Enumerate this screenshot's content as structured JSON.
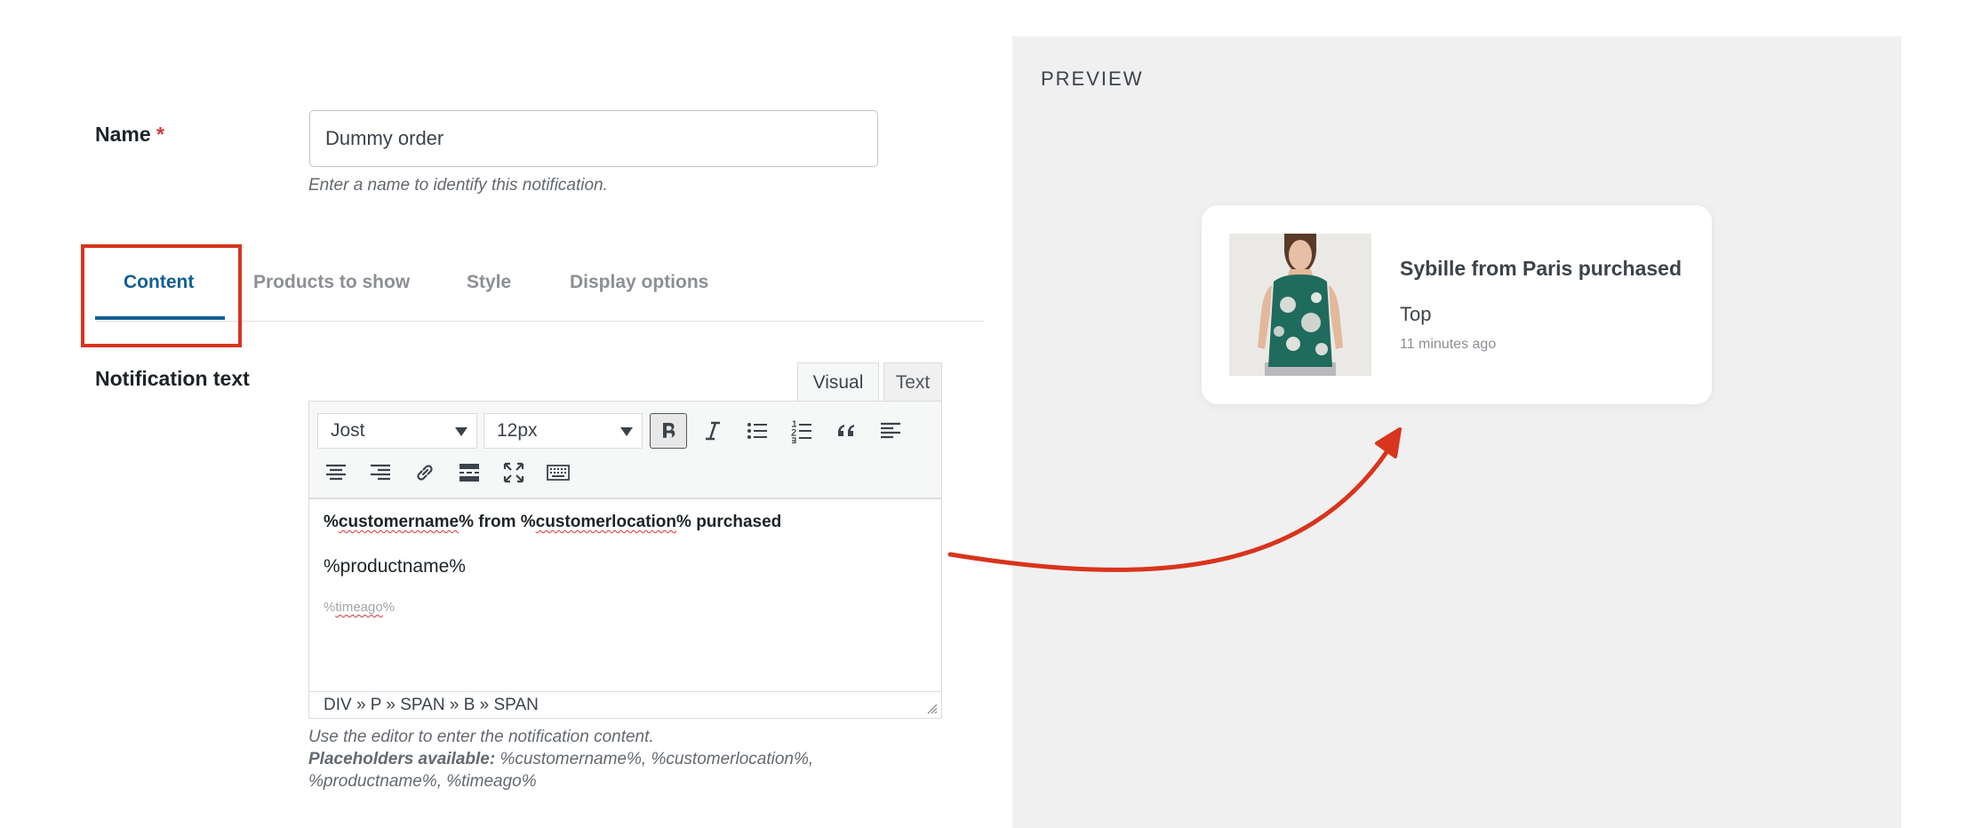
{
  "form": {
    "name_label": "Name",
    "required_mark": "*",
    "name_value": "Dummy order",
    "name_help": "Enter a name to identify this notification."
  },
  "tabs": [
    {
      "label": "Content",
      "active": true
    },
    {
      "label": "Products to show",
      "active": false
    },
    {
      "label": "Style",
      "active": false
    },
    {
      "label": "Display options",
      "active": false
    }
  ],
  "notification": {
    "label": "Notification text",
    "editor_modes": [
      "Visual",
      "Text"
    ],
    "active_mode": "Visual",
    "font_family": "Jost",
    "font_size": "12px",
    "content": {
      "line1_parts": [
        "%",
        "customername",
        "% from %",
        "customerlocation",
        "% purchased"
      ],
      "line2": "%productname%",
      "line3_parts": [
        "%",
        "timeago",
        "%"
      ]
    },
    "path": "DIV » P » SPAN » B » SPAN",
    "help_line": "Use the editor to enter the notification content.",
    "placeholders_label": "Placeholders available:",
    "placeholders_list": "%customername%, %customerlocation%,",
    "placeholders_list2": "%productname%, %timeago%"
  },
  "preview": {
    "title": "PREVIEW",
    "card_title": "Sybille from Paris purchased",
    "product": "Top",
    "time": "11 minutes ago"
  },
  "toolbar_icons": [
    "bold-icon",
    "italic-icon",
    "bullet-list-icon",
    "numbered-list-icon",
    "blockquote-icon",
    "align-left-icon",
    "align-center-icon",
    "align-right-icon",
    "link-icon",
    "read-more-icon",
    "fullscreen-icon",
    "keyboard-icon"
  ],
  "colors": {
    "accent": "#135e96",
    "highlight_box": "#d9341c",
    "arrow": "#d9341c",
    "required": "#d63638"
  }
}
